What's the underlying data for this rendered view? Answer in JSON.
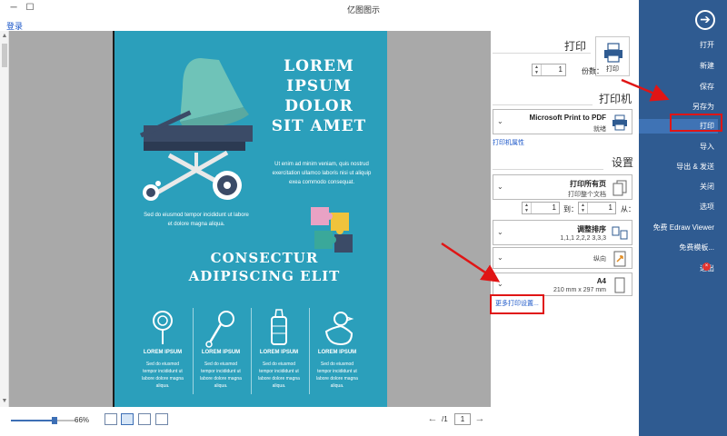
{
  "window": {
    "title": "亿图图示",
    "minimize_glyph": "─",
    "maximize_glyph": "☐",
    "login_link": "登录"
  },
  "poster": {
    "title": "LOREM\nIPSUM\nDOLOR\nSIT AMET",
    "para_right": "Ut enim ad minim veniam, quis nostrud\nexercitation ullamco laboris nisi ut aliquip\nexea commodo consequat.",
    "para_left": "Sed do eiusmod tempor incididunt ut labore\net dolore magna aliqua.",
    "subtitle": "CONSECTUR\nADIPISCING ELIT",
    "columns": [
      {
        "title": "LOREM IPSUM",
        "body": "Sed do eiusmod\ntempor incididunt ut\nlabore dolore magna\naliqua.",
        "icon": "duck-icon"
      },
      {
        "title": "LOREM IPSUM",
        "body": "Sed do eiusmod\ntempor incididunt ut\nlabore dolore magna\naliqua.",
        "icon": "baby-bottle-icon"
      },
      {
        "title": "LOREM IPSUM",
        "body": "Sed do eiusmod\ntempor incididunt ut\nlabore dolore magna\naliqua.",
        "icon": "rattle-icon"
      },
      {
        "title": "LOREM IPSUM",
        "body": "Sed do eiusmod\ntempor incididunt ut\nlabore dolore magna\naliqua.",
        "icon": "teether-icon"
      }
    ]
  },
  "status": {
    "zoom": "66%",
    "page_current": "1",
    "page_total": "/1"
  },
  "print_panel": {
    "print_heading": "打印",
    "print_button": "打印",
    "copies_label": "份数：",
    "copies_value": "1",
    "printer_heading": "打印机",
    "printer_name": "Microsoft Print to PDF",
    "printer_status": "就绪",
    "printer_properties": "打印机属性",
    "settings_heading": "设置",
    "pages_title": "打印所有页",
    "pages_sub": "打印整个文档",
    "from_label": "从：",
    "from_value": "1",
    "to_label": "到：",
    "to_value": "1",
    "collate_title": "调整排序",
    "collate_sub": "1,1,1  2,2,2  3,3,3",
    "orientation": "纵向",
    "paper_title": "A4",
    "paper_size": "210 mm x 297 mm",
    "more_settings": "更多打印设置..."
  },
  "sidebar": {
    "back_glyph": "➔",
    "items": [
      {
        "label": "打开"
      },
      {
        "label": "新建"
      },
      {
        "label": "保存"
      },
      {
        "label": "另存为"
      },
      {
        "label": "打印"
      },
      {
        "label": "导入"
      },
      {
        "label": "导出 & 发送"
      },
      {
        "label": "关闭"
      },
      {
        "label": "选项"
      },
      {
        "label": "免费 Edraw Viewer"
      },
      {
        "label": "免费模板..."
      },
      {
        "label": "退出"
      }
    ],
    "exit_mark": "×"
  },
  "colors": {
    "sidebar": "#2f5b91",
    "sidebar_active": "#3f73b5",
    "poster_bg": "#2b9fbb",
    "annotation_red": "#e01515",
    "link_blue": "#1a56c8"
  }
}
